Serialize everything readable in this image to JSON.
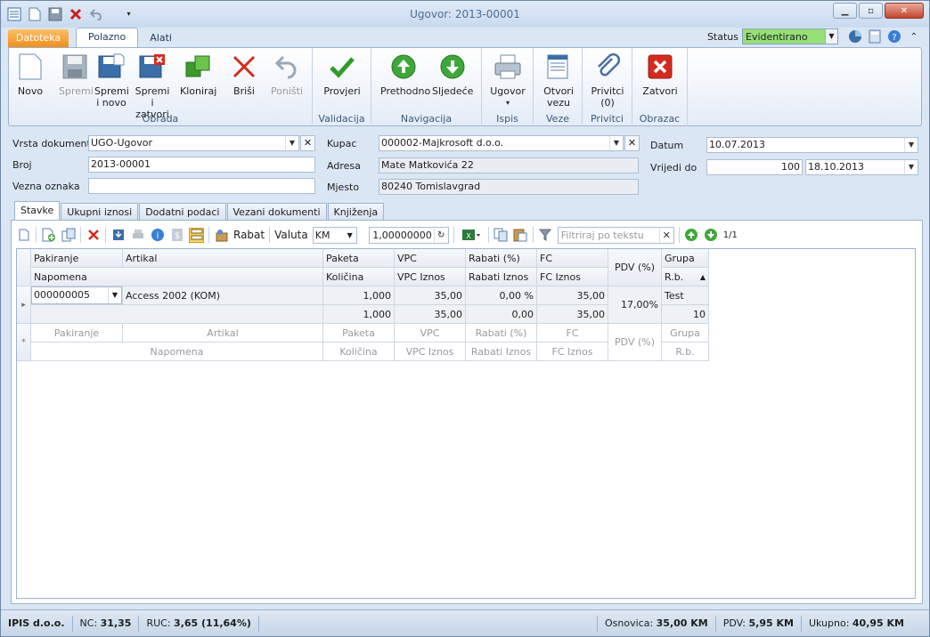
{
  "window": {
    "title": "Ugovor: 2013-00001"
  },
  "ribbon_tabs": [
    "Datoteka",
    "Polazno",
    "Alati"
  ],
  "status": {
    "label": "Status",
    "value": "Evidentirano",
    "color": "#96e077"
  },
  "ribbon": {
    "groups": [
      "Obrada",
      "Validacija",
      "Navigacija",
      "Ispis",
      "Veze",
      "Privitci",
      "Obrazac"
    ],
    "buttons": {
      "novo": "Novo",
      "spremi": "Spremi",
      "spremi_novo": [
        "Spremi",
        "i novo"
      ],
      "spremi_zatvori": [
        "Spremi i",
        "zatvori"
      ],
      "kloniraj": "Kloniraj",
      "brisi": "Briši",
      "ponisti": "Poništi",
      "provjeri": "Provjeri",
      "prethodno": "Prethodno",
      "sljedece": "Sljedeće",
      "ugovor": "Ugovor",
      "otvori_vezu": [
        "Otvori",
        "vezu"
      ],
      "privitci": [
        "Privitci",
        "(0)"
      ],
      "zatvori": "Zatvori"
    }
  },
  "form": {
    "vrsta_dokumenta": {
      "label": "Vrsta dokumenta",
      "value": "UGO-Ugovor"
    },
    "broj": {
      "label": "Broj",
      "value": "2013-00001"
    },
    "vezna_oznaka": {
      "label": "Vezna oznaka",
      "value": ""
    },
    "kupac": {
      "label": "Kupac",
      "value": "000002-Majkrosoft d.o.o."
    },
    "adresa": {
      "label": "Adresa",
      "value": "Mate Matkovića 22"
    },
    "mjesto": {
      "label": "Mjesto",
      "value": "80240 Tomislavgrad"
    },
    "datum": {
      "label": "Datum",
      "value": "10.07.2013"
    },
    "vrijedi_do": {
      "label": "Vrijedi do",
      "days": "100",
      "date": "18.10.2013"
    }
  },
  "detail_tabs": [
    "Stavke",
    "Ukupni iznosi",
    "Dodatni podaci",
    "Vezani dokumenti",
    "Knjiženja"
  ],
  "grid_toolbar": {
    "rabat": "Rabat",
    "valuta_label": "Valuta",
    "valuta": "KM",
    "tecaj": "1,00000000",
    "filter_placeholder": "Filtriraj po tekstu",
    "page": "1/1"
  },
  "grid": {
    "headers_row1": [
      "Pakiranje",
      "Artikal",
      "Paketa",
      "VPC",
      "Rabati (%)",
      "FC",
      "PDV (%)",
      "Grupa"
    ],
    "headers_row2": [
      "Napomena",
      "Količina",
      "VPC Iznos",
      "Rabati Iznos",
      "FC Iznos",
      "R.b."
    ],
    "row": {
      "pakiranje": "000000005",
      "artikal": "Access 2002 (KOM)",
      "paketa": "1,000",
      "vpc": "35,00",
      "rabati": "0,00 %",
      "fc": "35,00",
      "pdv": "17,00%",
      "grupa": "Test",
      "kolicina": "1,000",
      "vpc_iznos": "35,00",
      "rabati_iznos": "0,00",
      "fc_iznos": "35,00",
      "rb": "10"
    },
    "new_row1": [
      "Pakiranje",
      "Artikal",
      "Paketa",
      "VPC",
      "Rabati (%)",
      "FC",
      "PDV (%)",
      "Grupa"
    ],
    "new_row2": [
      "Napomena",
      "Količina",
      "VPC Iznos",
      "Rabati Iznos",
      "FC Iznos",
      "R.b."
    ]
  },
  "statusbar": {
    "company": "IPIS d.o.o.",
    "nc_label": "NC:",
    "nc": "31,35",
    "ruc_label": "RUC:",
    "ruc": "3,65 (11,64%)",
    "osnovica_label": "Osnovica:",
    "osnovica": "35,00 KM",
    "pdv_label": "PDV:",
    "pdv": "5,95 KM",
    "ukupno_label": "Ukupno:",
    "ukupno": "40,95 KM"
  }
}
